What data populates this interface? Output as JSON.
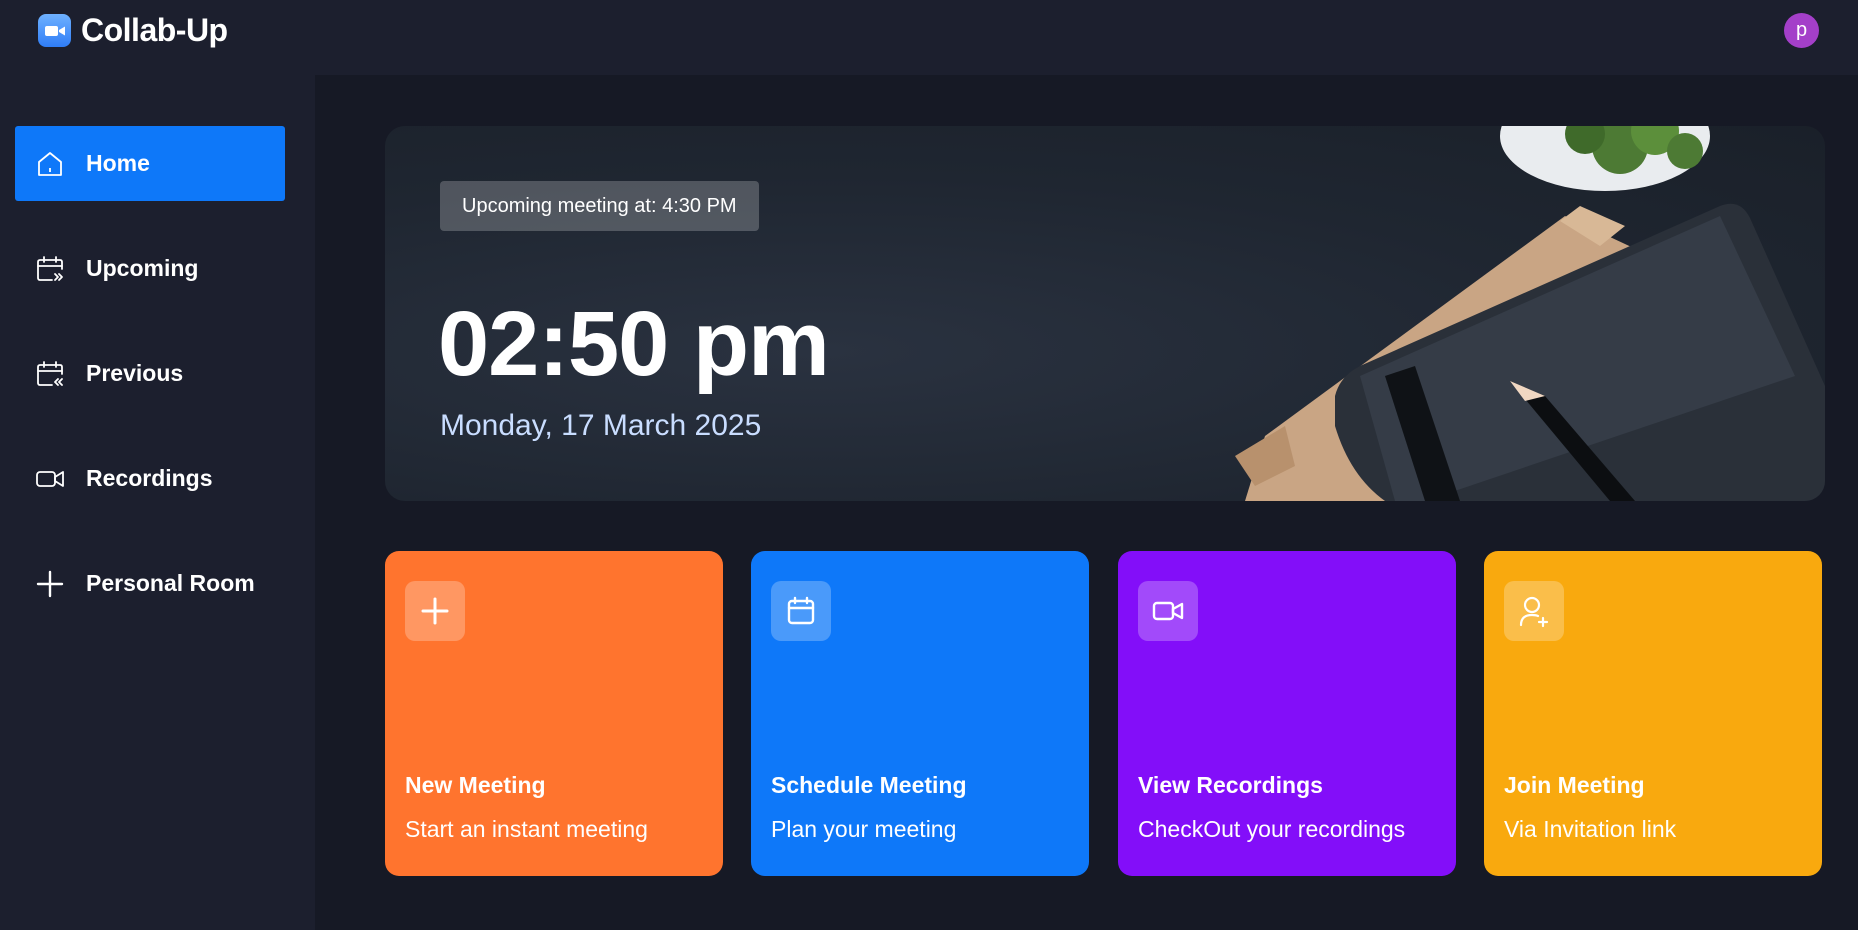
{
  "app": {
    "name": "Collab-Up",
    "user_initial": "p"
  },
  "sidebar": {
    "items": [
      {
        "label": "Home",
        "icon": "home-icon",
        "active": true
      },
      {
        "label": "Upcoming",
        "icon": "calendar-upcoming-icon",
        "active": false
      },
      {
        "label": "Previous",
        "icon": "calendar-previous-icon",
        "active": false
      },
      {
        "label": "Recordings",
        "icon": "video-icon",
        "active": false
      },
      {
        "label": "Personal Room",
        "icon": "plus-icon",
        "active": false
      }
    ]
  },
  "hero": {
    "upcoming_badge": "Upcoming meeting at: 4:30 PM",
    "time": "02:50 pm",
    "date": "Monday, 17 March 2025"
  },
  "cards": [
    {
      "title": "New Meeting",
      "subtitle": "Start an instant meeting",
      "icon": "plus-icon",
      "color": "#ff742e"
    },
    {
      "title": "Schedule Meeting",
      "subtitle": "Plan your meeting",
      "icon": "calendar-icon",
      "color": "#0e78f9"
    },
    {
      "title": "View Recordings",
      "subtitle": "CheckOut your recordings",
      "icon": "video-icon",
      "color": "#830ef9"
    },
    {
      "title": "Join Meeting",
      "subtitle": "Via Invitation link",
      "icon": "user-plus-icon",
      "color": "#f9a90e"
    }
  ],
  "colors": {
    "background": "#161925",
    "panel": "#1c1f2e",
    "accent": "#0e78f9"
  }
}
